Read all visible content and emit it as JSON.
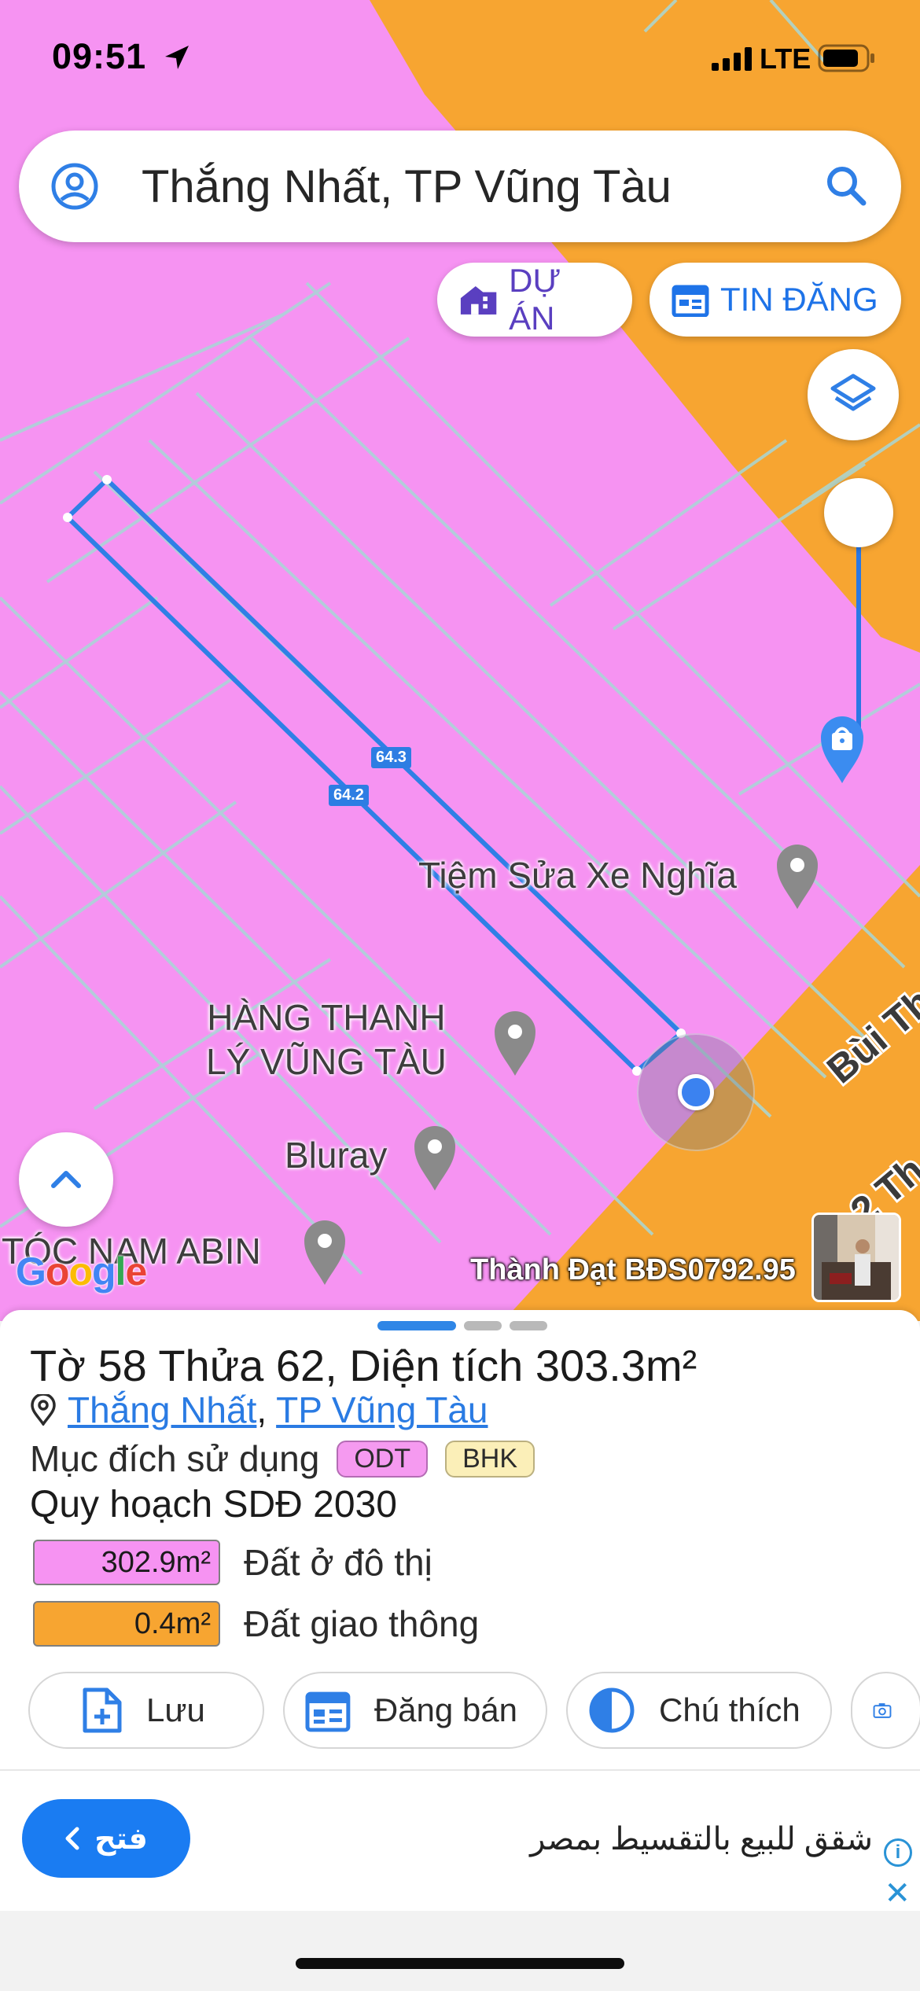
{
  "status": {
    "time": "09:51",
    "network": "LTE"
  },
  "search": {
    "text": "Thắng Nhất, TP Vũng Tàu"
  },
  "chips": {
    "project": "DỰ ÁN",
    "listings": "TIN ĐĂNG"
  },
  "map": {
    "plot_labels": [
      "64.3",
      "64.2"
    ],
    "pois": [
      {
        "label": "Tiệm Sửa Xe Nghĩa"
      },
      {
        "label": "HÀNG THANH\nLÝ VŨNG TÀU"
      },
      {
        "label": "Bluray"
      },
      {
        "label": "TÓC NAM ABIN"
      }
    ],
    "road_label_1": "Bùi Th",
    "road_label_2": "2 Th",
    "logo": "Google",
    "watermark": "Thành Đạt BĐS0792.95",
    "colors": {
      "residential": "#f693f2",
      "transport": "#f7a531",
      "plot_outline": "#2f7fe6"
    }
  },
  "sheet": {
    "title_prefix": "Tờ ",
    "sheet_no": "58",
    "title_mid": " Thửa ",
    "parcel_no": "62",
    "title_suffix": ", Diện tích ",
    "area": "303.3m²",
    "ward": "Thắng Nhất",
    "city": "TP Vũng Tàu",
    "purpose_label": "Mục đích sử dụng",
    "purpose_tags": [
      "ODT",
      "BHK"
    ],
    "plan_title": "Quy hoạch SDĐ 2030",
    "legend": [
      {
        "value": "302.9m²",
        "label": "Đất ở đô thị",
        "color": "#f693f2"
      },
      {
        "value": "0.4m²",
        "label": "Đất giao thông",
        "color": "#f7a531"
      }
    ],
    "actions": {
      "save": "Lưu",
      "post": "Đăng bán",
      "legend": "Chú thích"
    }
  },
  "ad": {
    "button": "فتح",
    "text": "شقق للبيع بالتقسيط بمصر",
    "info": "i",
    "close": "✕"
  }
}
